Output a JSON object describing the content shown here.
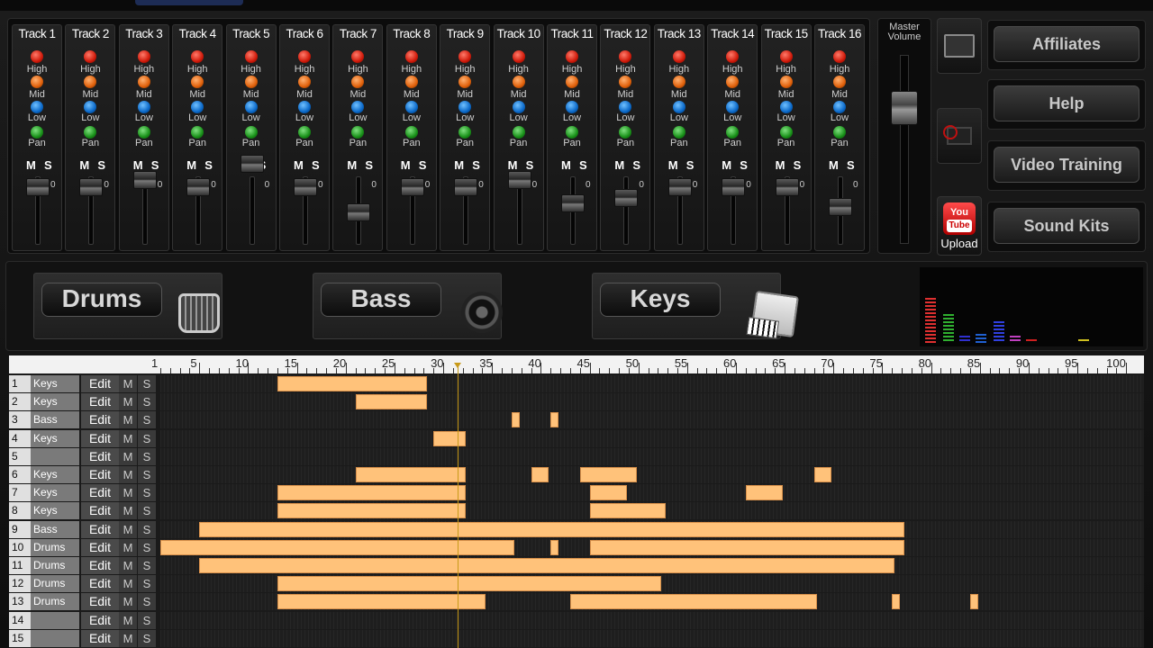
{
  "mixer": {
    "tracks": [
      "Track 1",
      "Track 2",
      "Track 3",
      "Track 4",
      "Track 5",
      "Track 6",
      "Track 7",
      "Track 8",
      "Track 9",
      "Track 10",
      "Track 11",
      "Track 12",
      "Track 13",
      "Track 14",
      "Track 15",
      "Track 16"
    ],
    "knob_labels": {
      "high": "High",
      "mid": "Mid",
      "low": "Low",
      "pan": "Pan"
    },
    "mute_label": "M",
    "solo_label": "S",
    "fader_zero": "0"
  },
  "master": {
    "label_line1": "Master",
    "label_line2": "Volume"
  },
  "tools": {
    "youtube_you": "You",
    "youtube_tube": "Tube",
    "upload_label": "Upload"
  },
  "nav": {
    "affiliates": "Affiliates",
    "help": "Help",
    "video_training": "Video Training",
    "sound_kits": "Sound Kits"
  },
  "instruments": {
    "drums": "Drums",
    "bass": "Bass",
    "keys": "Keys"
  },
  "analyzer": {
    "colors": [
      "#e03030",
      "#30b030",
      "#3030d0",
      "#2060d0",
      "#3040e0",
      "#c040c0",
      "#d02020",
      "#d0c020"
    ]
  },
  "ruler": {
    "labels": [
      "1",
      "5",
      "10",
      "15",
      "20",
      "25",
      "30",
      "35",
      "40",
      "45",
      "50",
      "55",
      "60",
      "65",
      "70",
      "75",
      "80",
      "85",
      "90",
      "95",
      "100"
    ]
  },
  "sequencer": {
    "edit_label": "Edit",
    "mute_label": "M",
    "solo_label": "S",
    "playhead_bar": 31.5,
    "rows": [
      {
        "num": "1",
        "name": "Keys",
        "blocks": [
          [
            13,
            28
          ]
        ]
      },
      {
        "num": "2",
        "name": "Keys",
        "blocks": [
          [
            21,
            28
          ]
        ]
      },
      {
        "num": "3",
        "name": "Bass",
        "blocks": [
          [
            37,
            37.5
          ],
          [
            41,
            41.5
          ]
        ]
      },
      {
        "num": "4",
        "name": "Keys",
        "blocks": [
          [
            29,
            32
          ]
        ]
      },
      {
        "num": "5",
        "name": "",
        "blocks": []
      },
      {
        "num": "6",
        "name": "Keys",
        "blocks": [
          [
            21,
            32
          ],
          [
            39,
            40.5
          ],
          [
            44,
            49.5
          ],
          [
            68,
            69.5
          ]
        ]
      },
      {
        "num": "7",
        "name": "Keys",
        "blocks": [
          [
            13,
            32
          ],
          [
            45,
            48.5
          ],
          [
            61,
            64.5
          ]
        ]
      },
      {
        "num": "8",
        "name": "Keys",
        "blocks": [
          [
            13,
            32
          ],
          [
            45,
            52.5
          ]
        ]
      },
      {
        "num": "9",
        "name": "Bass",
        "blocks": [
          [
            5,
            77
          ]
        ]
      },
      {
        "num": "10",
        "name": "Drums",
        "blocks": [
          [
            1,
            37
          ],
          [
            41,
            41.5
          ],
          [
            45,
            77
          ]
        ]
      },
      {
        "num": "11",
        "name": "Drums",
        "blocks": [
          [
            5,
            76
          ]
        ]
      },
      {
        "num": "12",
        "name": "Drums",
        "blocks": [
          [
            13,
            52
          ]
        ]
      },
      {
        "num": "13",
        "name": "Drums",
        "blocks": [
          [
            13,
            34
          ],
          [
            43,
            68
          ],
          [
            76,
            76.5
          ],
          [
            84,
            84.5
          ]
        ]
      },
      {
        "num": "14",
        "name": "",
        "blocks": []
      },
      {
        "num": "15",
        "name": "",
        "blocks": []
      }
    ]
  }
}
